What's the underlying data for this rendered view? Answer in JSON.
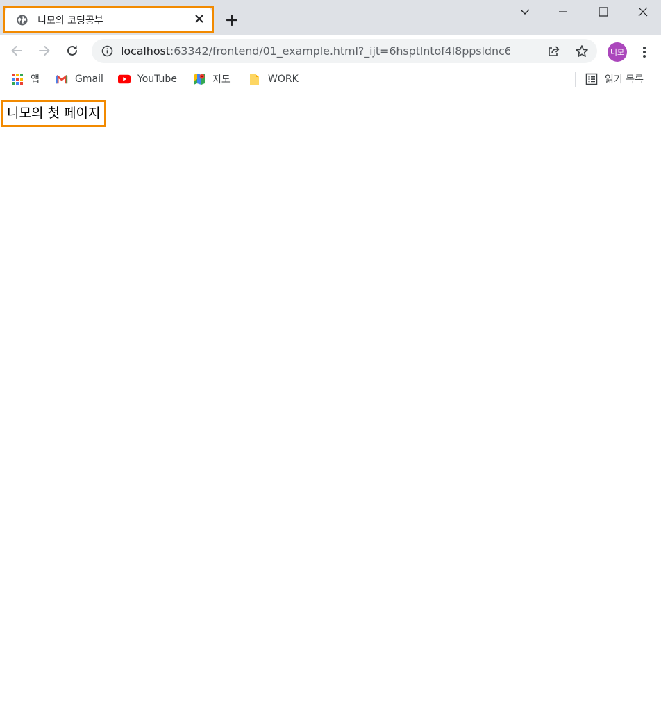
{
  "browser": {
    "tab": {
      "title": "니모의 코딩공부",
      "favicon": "globe-icon",
      "close_icon": "close-icon"
    },
    "new_tab_icon": "plus-icon",
    "window_controls": [
      "chevron-down-icon",
      "minimize-icon",
      "maximize-icon",
      "close-icon"
    ],
    "highlight_color": "#f28a00"
  },
  "toolbar": {
    "back_icon": "back-arrow-icon",
    "forward_icon": "forward-arrow-icon",
    "reload_icon": "reload-icon",
    "url_host": "localhost",
    "url_rest": ":63342/frontend/01_example.html?_ijt=6hsptlntof4l8ppsldnc6guh...",
    "share_icon": "share-icon",
    "bookmark_icon": "star-icon",
    "profile_initials": "니모",
    "profile_color": "#ab47bc",
    "menu_icon": "kebab-menu-icon"
  },
  "bookmarks": {
    "items": [
      {
        "label": "앱",
        "icon": "apps-grid-icon"
      },
      {
        "label": "Gmail",
        "icon": "gmail-icon"
      },
      {
        "label": "YouTube",
        "icon": "youtube-icon"
      },
      {
        "label": "지도",
        "icon": "maps-icon"
      },
      {
        "label": "WORK",
        "icon": "folder-icon"
      }
    ],
    "reading_list": {
      "label": "읽기 목록",
      "icon": "reading-list-icon"
    }
  },
  "page": {
    "heading": "니모의 첫 페이지"
  }
}
